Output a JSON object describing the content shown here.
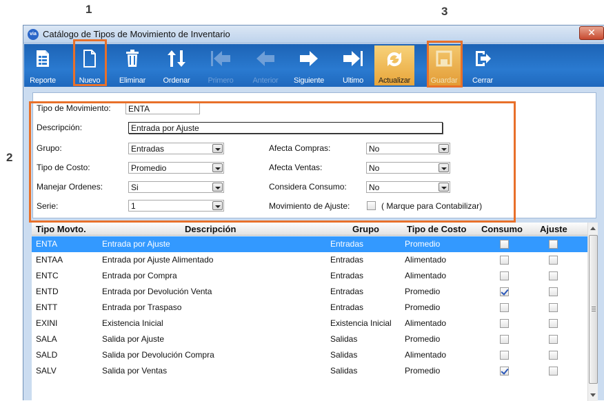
{
  "annotations": [
    "1",
    "2",
    "3"
  ],
  "window": {
    "title": "Catálogo de Tipos de Movimiento de Inventario",
    "close": "✕",
    "app_icon": "via"
  },
  "toolbar": {
    "reporte": "Reporte",
    "nuevo": "Nuevo",
    "eliminar": "Eliminar",
    "ordenar": "Ordenar",
    "primero": "Primero",
    "anterior": "Anterior",
    "siguiente": "Siguiente",
    "ultimo": "Ultimo",
    "actualizar": "Actualizar",
    "guardar": "Guardar",
    "cerrar": "Cerrar"
  },
  "form": {
    "tipo_label": "Tipo de Movimiento:",
    "tipo_value": "ENTA",
    "desc_label": "Descripción:",
    "desc_value": "Entrada por Ajuste",
    "grupo_label": "Grupo:",
    "grupo_value": "Entradas",
    "costo_label": "Tipo de Costo:",
    "costo_value": "Promedio",
    "ordenes_label": "Manejar Ordenes:",
    "ordenes_value": "Si",
    "serie_label": "Serie:",
    "serie_value": "1",
    "compras_label": "Afecta Compras:",
    "compras_value": "No",
    "ventas_label": "Afecta Ventas:",
    "ventas_value": "No",
    "consumo_label": "Considera Consumo:",
    "consumo_value": "No",
    "ajuste_label": "Movimiento de Ajuste:",
    "ajuste_hint": "( Marque para Contabilizar)"
  },
  "grid": {
    "headers": [
      "Tipo  Movto.",
      "Descripción",
      "Grupo",
      "Tipo de Costo",
      "Consumo",
      "Ajuste"
    ],
    "rows": [
      {
        "tipo": "ENTA",
        "desc": "Entrada por Ajuste",
        "grupo": "Entradas",
        "costo": "Promedio",
        "consumo": false,
        "ajuste": false,
        "selected": true
      },
      {
        "tipo": "ENTAA",
        "desc": "Entrada por Ajuste Alimentado",
        "grupo": "Entradas",
        "costo": "Alimentado",
        "consumo": false,
        "ajuste": false
      },
      {
        "tipo": "ENTC",
        "desc": "Entrada por Compra",
        "grupo": "Entradas",
        "costo": "Alimentado",
        "consumo": false,
        "ajuste": false
      },
      {
        "tipo": "ENTD",
        "desc": "Entrada por Devolución Venta",
        "grupo": "Entradas",
        "costo": "Promedio",
        "consumo": true,
        "ajuste": false
      },
      {
        "tipo": "ENTT",
        "desc": "Entrada por Traspaso",
        "grupo": "Entradas",
        "costo": "Promedio",
        "consumo": false,
        "ajuste": false
      },
      {
        "tipo": "EXINI",
        "desc": "Existencia Inicial",
        "grupo": "Existencia Inicial",
        "costo": "Alimentado",
        "consumo": false,
        "ajuste": false
      },
      {
        "tipo": "SALA",
        "desc": "Salida por Ajuste",
        "grupo": "Salidas",
        "costo": "Promedio",
        "consumo": false,
        "ajuste": false
      },
      {
        "tipo": "SALD",
        "desc": "Salida por Devolución Compra",
        "grupo": "Salidas",
        "costo": "Alimentado",
        "consumo": false,
        "ajuste": false
      },
      {
        "tipo": "SALV",
        "desc": "Salida por Ventas",
        "grupo": "Salidas",
        "costo": "Promedio",
        "consumo": true,
        "ajuste": false
      }
    ]
  },
  "colors": {
    "toolbar": "#1f68bd",
    "selection": "#3399ff",
    "highlight": "#e8702a"
  }
}
